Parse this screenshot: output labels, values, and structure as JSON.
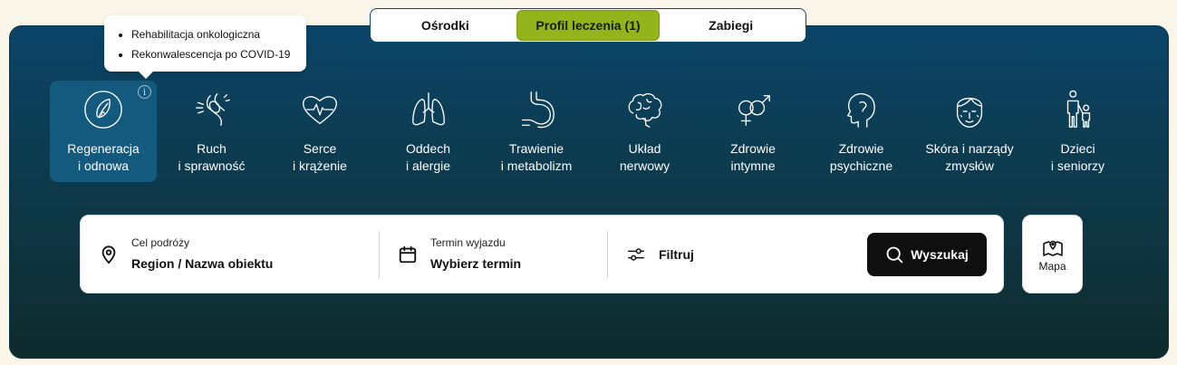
{
  "tabs": [
    {
      "label": "Ośrodki",
      "active": false
    },
    {
      "label": "Profil leczenia (1)",
      "active": true
    },
    {
      "label": "Zabiegi",
      "active": false
    }
  ],
  "tooltip": {
    "items": [
      "Rehabilitacja onkologiczna",
      "Rekonwalescencja po COVID-19"
    ],
    "info_glyph": "i"
  },
  "categories": [
    {
      "line1": "Regeneracja",
      "line2": "i odnowa",
      "icon": "leaf-icon",
      "selected": true
    },
    {
      "line1": "Ruch",
      "line2": "i sprawność",
      "icon": "knee-joint-icon"
    },
    {
      "line1": "Serce",
      "line2": "i krążenie",
      "icon": "heart-pulse-icon"
    },
    {
      "line1": "Oddech",
      "line2": "i alergie",
      "icon": "lungs-icon"
    },
    {
      "line1": "Trawienie",
      "line2": "i metabolizm",
      "icon": "stomach-icon"
    },
    {
      "line1": "Układ",
      "line2": "nerwowy",
      "icon": "brain-icon"
    },
    {
      "line1": "Zdrowie",
      "line2": "intymne",
      "icon": "gender-symbols-icon"
    },
    {
      "line1": "Zdrowie",
      "line2": "psychiczne",
      "icon": "head-profile-icon"
    },
    {
      "line1": "Skóra i narządy",
      "line2": "zmysłów",
      "icon": "face-icon"
    },
    {
      "line1": "Dzieci",
      "line2": "i seniorzy",
      "icon": "family-icon"
    }
  ],
  "search": {
    "destination": {
      "label": "Cel podróży",
      "value": "Region / Nazwa obiektu",
      "icon": "map-pin-icon"
    },
    "term": {
      "label": "Termin wyjazdu",
      "value": "Wybierz termin",
      "icon": "calendar-icon"
    },
    "filter": {
      "label": "Filtruj",
      "icon": "sliders-icon"
    },
    "button": {
      "label": "Wyszukaj",
      "icon": "search-icon"
    }
  },
  "map": {
    "label": "Mapa",
    "icon": "map-icon"
  },
  "colors": {
    "accent": "#93b41a",
    "panel_top": "#0b4468",
    "panel_bottom": "#0e2b2c",
    "selected_tile": "#145a7e",
    "page_bg": "#fbf6ea"
  }
}
